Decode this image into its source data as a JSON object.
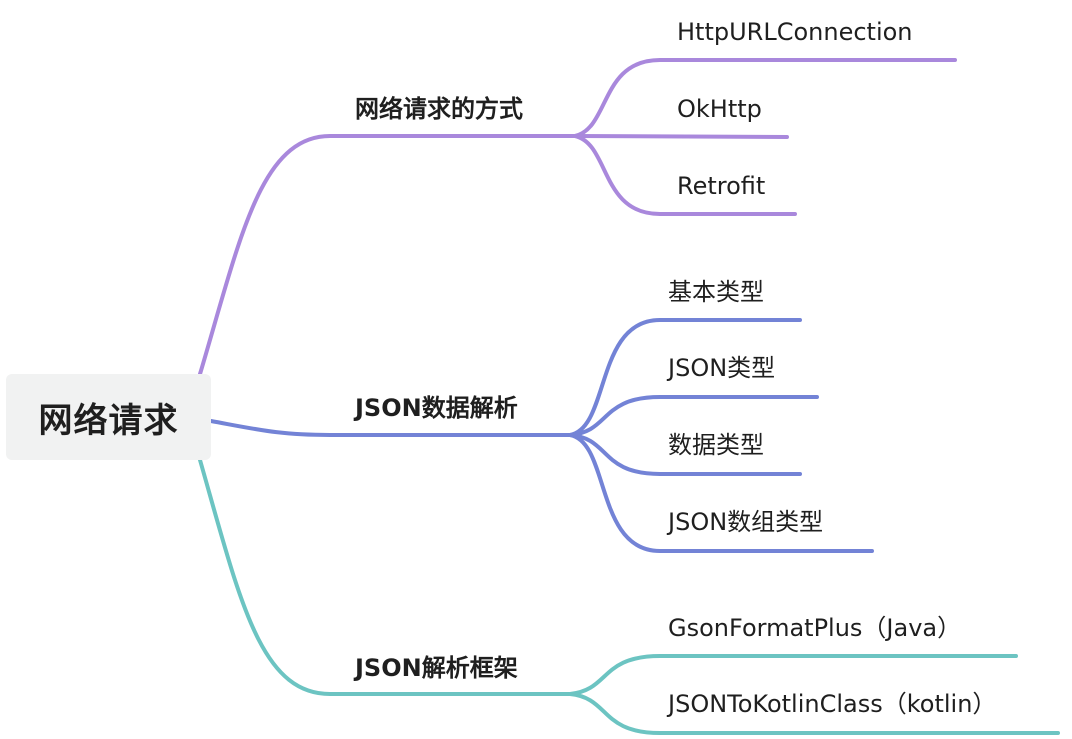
{
  "root": {
    "label": "网络请求"
  },
  "branches": [
    {
      "label": "网络请求的方式",
      "color": "#a988dc",
      "children": [
        "HttpURLConnection",
        "OkHttp",
        "Retrofit"
      ]
    },
    {
      "label": "JSON数据解析",
      "color": "#7383d6",
      "children": [
        "基本类型",
        "JSON类型",
        "数据类型",
        "JSON数组类型"
      ]
    },
    {
      "label": "JSON解析框架",
      "color": "#6cc4c2",
      "children": [
        "GsonFormatPlus（Java）",
        "JSONToKotlinClass（kotlin）"
      ]
    }
  ]
}
